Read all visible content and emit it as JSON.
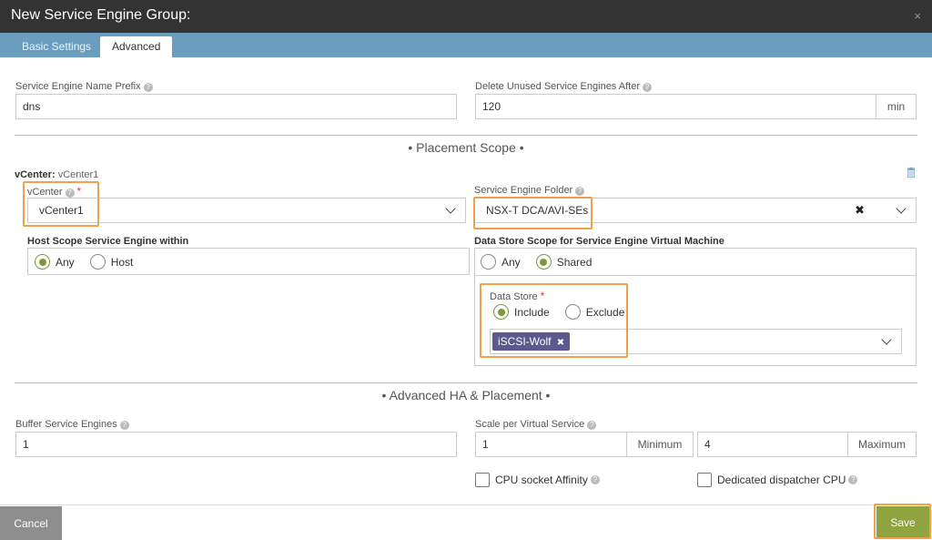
{
  "header": {
    "title": "New Service Engine Group:",
    "close": "×"
  },
  "tabs": [
    {
      "label": "Basic Settings"
    },
    {
      "label": "Advanced"
    }
  ],
  "fields": {
    "se_name_prefix": {
      "label": "Service Engine Name Prefix",
      "value": "dns"
    },
    "delete_unused": {
      "label": "Delete Unused Service Engines After",
      "value": "120",
      "unit": "min"
    },
    "buffer_se": {
      "label": "Buffer Service Engines",
      "value": "1"
    },
    "scale_per_vs": {
      "label": "Scale per Virtual Service",
      "min_value": "1",
      "min_label": "Minimum",
      "max_value": "4",
      "max_label": "Maximum"
    }
  },
  "placement_scope": {
    "title": "• Placement Scope •",
    "vcenter_header_label": "vCenter:",
    "vcenter_header_value": "vCenter1",
    "vcenter_label": "vCenter",
    "vcenter_value": "vCenter1",
    "se_folder_label": "Service Engine Folder",
    "se_folder_value": "NSX-T DCA/AVI-SEs",
    "host_scope_label": "Host Scope Service Engine within",
    "host_scope_options": [
      "Any",
      "Host"
    ],
    "host_scope_selected": "Any",
    "datastore_scope_label": "Data Store Scope for Service Engine Virtual Machine",
    "datastore_scope_options": [
      "Any",
      "Shared"
    ],
    "datastore_scope_selected": "Shared",
    "datastore_label": "Data Store",
    "datastore_options": [
      "Include",
      "Exclude"
    ],
    "datastore_selected": "Include",
    "datastore_tag": "iSCSI-Wolf"
  },
  "advanced_ha": {
    "title": "• Advanced HA & Placement •",
    "cpu_socket_affinity": "CPU socket Affinity",
    "dedicated_dispatcher": "Dedicated dispatcher CPU"
  },
  "footer": {
    "cancel": "Cancel",
    "save": "Save"
  },
  "colors": {
    "header_bg": "#333333",
    "tab_bar": "#6a9ebf",
    "accent_green": "#8fa33f",
    "highlight": "#f0a14a",
    "tag_bg": "#5a5a8e"
  },
  "icons": [
    "help-icon",
    "close-icon",
    "chevron-down-icon",
    "trash-icon",
    "remove-tag-icon",
    "clear-icon"
  ]
}
